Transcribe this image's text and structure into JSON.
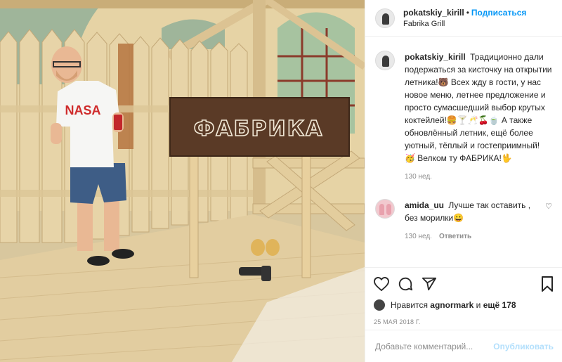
{
  "post": {
    "image_alt": "Man in NASA t-shirt next to a wooden sign in a fenced summer terrace",
    "sign_text": "ФАБРИКА",
    "shirt_text": "NASA"
  },
  "header": {
    "username": "pokatskiy_kirill",
    "separator": "•",
    "follow_label": "Подписаться",
    "location": "Fabrika Grill"
  },
  "caption": {
    "username": "pokatskiy_kirill",
    "text": "Традиционно дали подержаться за кисточку на открытии летника!🐻 Всех жду в гости, у нас новое меню, летнее предложение и просто сумасшедший выбор крутых коктейлей!🍔🍸🥂🍒🍵 А также обновлённый летник, ещё более уютный, тёплый и гостеприимный! 🥳 Велком ту ФАБРИКА!🖖",
    "time": "130 нед."
  },
  "comment": {
    "username": "amida_uu",
    "text": "Лучше так оставить , без морилки😀",
    "time": "130 нед.",
    "reply_label": "Ответить"
  },
  "likes": {
    "prefix": "Нравится",
    "user": "agnormark",
    "conj": "и",
    "more": "ещё 178"
  },
  "date": "25 МАЯ 2018 Г.",
  "add_comment": {
    "placeholder": "Добавьте комментарий...",
    "post_label": "Опубликовать"
  },
  "colors": {
    "link_blue": "#0095f6",
    "post_disabled": "#b2dffc",
    "muted": "#8e8e8e"
  }
}
